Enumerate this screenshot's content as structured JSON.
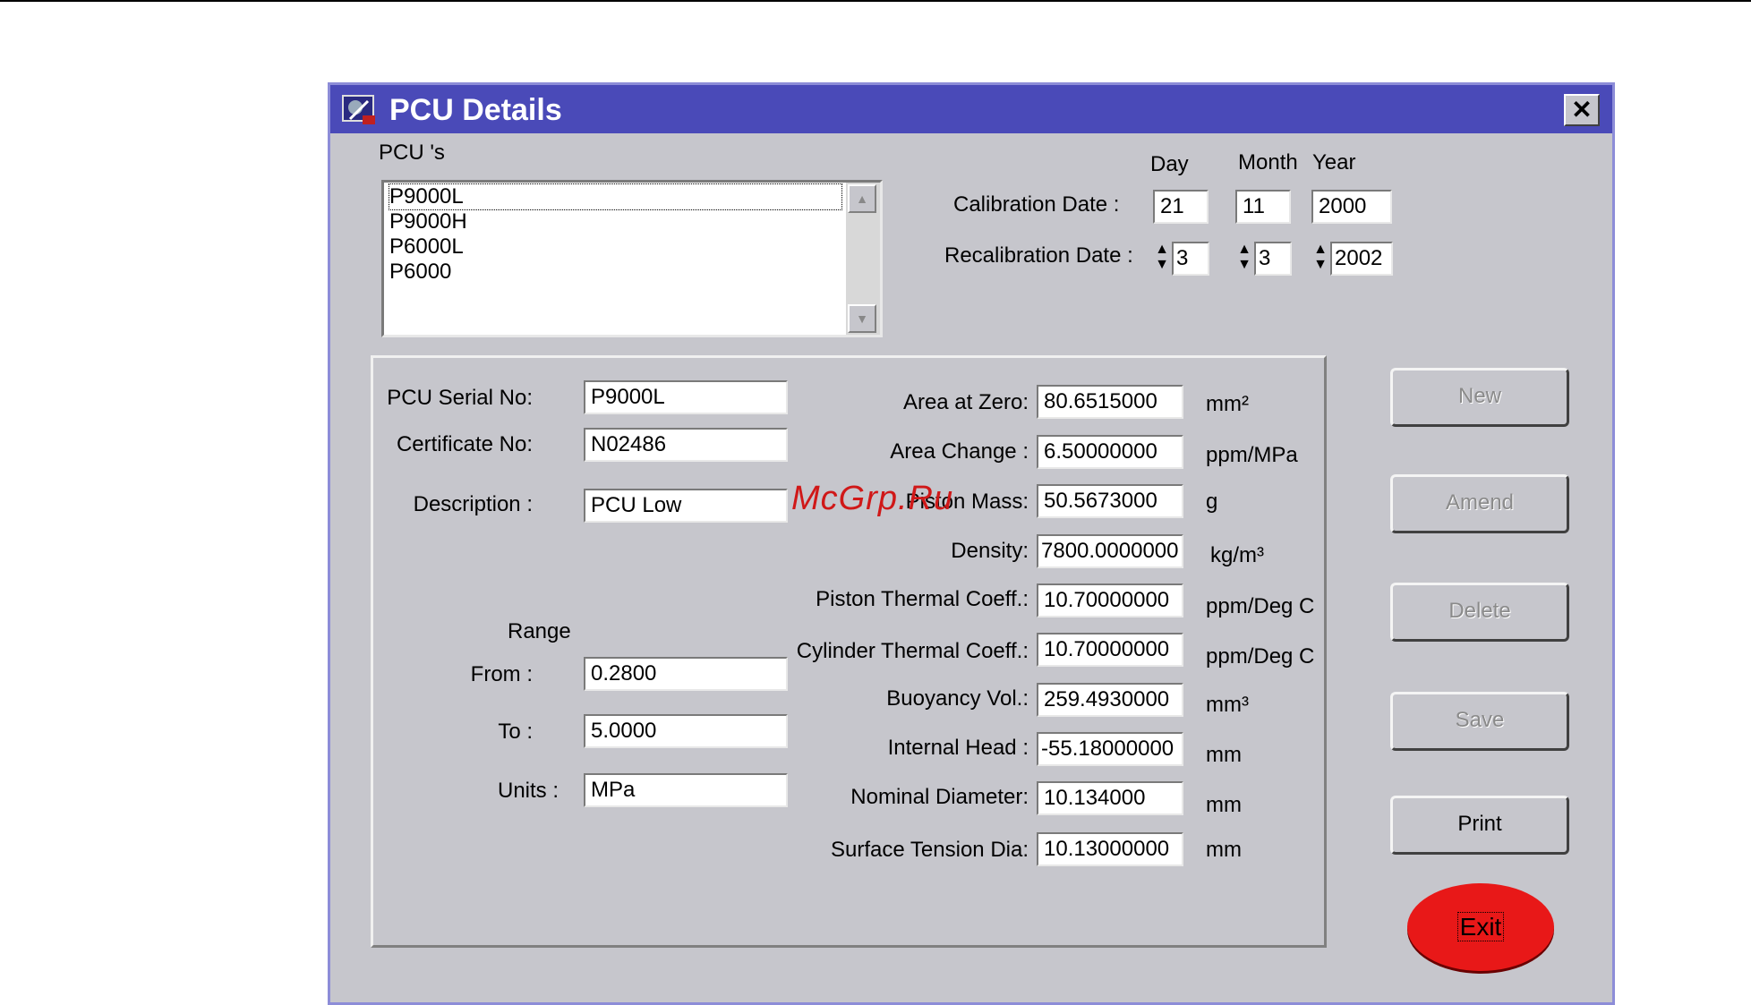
{
  "window": {
    "title": "PCU Details",
    "close_label": "✕"
  },
  "pcu_list": {
    "label": "PCU 's",
    "items": [
      "P9000L",
      "P9000H",
      "P6000L",
      "P6000"
    ],
    "selected": "P9000L"
  },
  "dates": {
    "day_header": "Day",
    "month_header": "Month",
    "year_header": "Year",
    "calibration_label": "Calibration Date :",
    "calibration": {
      "day": "21",
      "month": "11",
      "year": "2000"
    },
    "recalibration_label": "Recalibration Date :",
    "recalibration": {
      "day": "3",
      "month": "3",
      "year": "2002"
    }
  },
  "details": {
    "serial_label": "PCU Serial No:",
    "serial": "P9000L",
    "certificate_label": "Certificate No:",
    "certificate": "N02486",
    "description_label": "Description :",
    "description": "PCU Low",
    "range_label": "Range",
    "from_label": "From :",
    "from": "0.2800",
    "to_label": "To :",
    "to": "5.0000",
    "units_label": "Units :",
    "units": "MPa"
  },
  "parameters": [
    {
      "label": "Area at Zero:",
      "value": "80.6515000",
      "unit": "mm²"
    },
    {
      "label": "Area Change :",
      "value": "6.50000000",
      "unit": "ppm/MPa"
    },
    {
      "label": "Piston Mass:",
      "value": "50.5673000",
      "unit": "g"
    },
    {
      "label": "Density:",
      "value": "7800.0000000",
      "unit": "kg/m³"
    },
    {
      "label": "Piston Thermal Coeff.:",
      "value": "10.70000000",
      "unit": "ppm/Deg C"
    },
    {
      "label": "Cylinder Thermal Coeff.:",
      "value": "10.70000000",
      "unit": "ppm/Deg C"
    },
    {
      "label": "Buoyancy Vol.:",
      "value": "259.4930000",
      "unit": "mm³"
    },
    {
      "label": "Internal Head :",
      "value": "-55.18000000",
      "unit": "mm"
    },
    {
      "label": "Nominal Diameter:",
      "value": "10.134000",
      "unit": "mm"
    },
    {
      "label": "Surface Tension Dia:",
      "value": "10.13000000",
      "unit": "mm"
    }
  ],
  "buttons": {
    "new": "New",
    "amend": "Amend",
    "delete": "Delete",
    "save": "Save",
    "print": "Print",
    "exit": "Exit"
  },
  "watermark": "McGrp.Ru"
}
